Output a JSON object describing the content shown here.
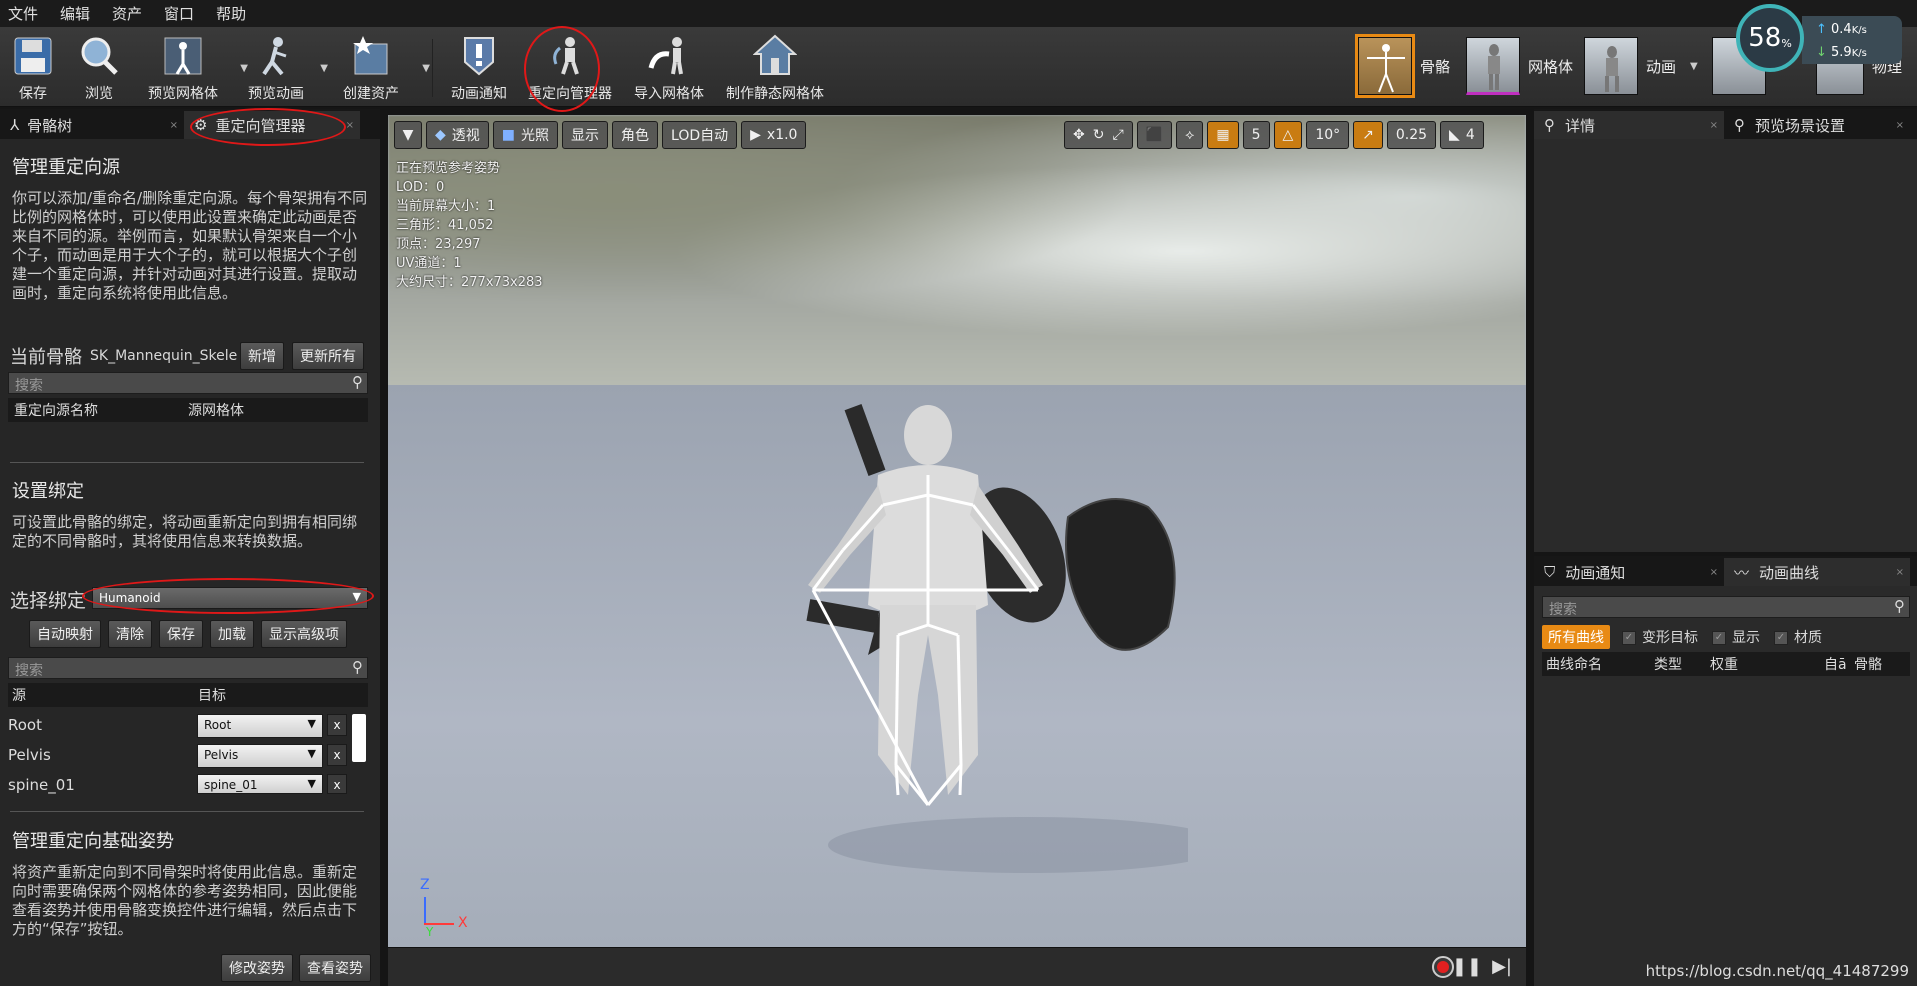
{
  "menu": [
    "文件",
    "编辑",
    "资产",
    "窗口",
    "帮助"
  ],
  "toolbar": {
    "save": "保存",
    "browse": "浏览",
    "preview_mesh": "预览网格体",
    "preview_anim": "预览动画",
    "create_asset": "创建资产",
    "anim_notify": "动画通知",
    "retarget_manager": "重定向管理器",
    "import_mesh": "导入网格体",
    "make_static_mesh": "制作静态网格体"
  },
  "modes": {
    "skeleton": "骨骼",
    "mesh": "网格体",
    "animation": "动画",
    "physics": "物理"
  },
  "net": {
    "percent": "58",
    "percent_unit": "%",
    "up": "0.4",
    "down": "5.9",
    "unit": "K/s"
  },
  "left_tabs": {
    "skeleton_tree": "骨骼树",
    "retarget_manager": "重定向管理器"
  },
  "manage_sources": {
    "title": "管理重定向源",
    "desc": "你可以添加/重命名/删除重定向源。每个骨架拥有不同比例的网格体时，可以使用此设置来确定此动画是否来自不同的源。举例而言，如果默认骨架来自一个小个子，而动画是用于大个子的，就可以根据大个子创建一个重定向源，并针对动画对其进行设置。提取动画时，重定向系统将使用此信息。",
    "current_skeleton_label": "当前骨骼",
    "current_skeleton_value": "SK_Mannequin_Skele",
    "add": "新增",
    "update_all": "更新所有",
    "search_placeholder": "搜索",
    "col_name": "重定向源名称",
    "col_mesh": "源网格体"
  },
  "rig": {
    "title": "设置绑定",
    "desc": "可设置此骨骼的绑定，将动画重新定向到拥有相同绑定的不同骨骼时，其将使用信息来转换数据。",
    "select_label": "选择绑定",
    "select_value": "Humanoid",
    "auto_map": "自动映射",
    "clear": "清除",
    "save": "保存",
    "load": "加载",
    "show_advanced": "显示高级项",
    "search_placeholder": "搜索",
    "col_source": "源",
    "col_target": "目标",
    "rows": [
      {
        "source": "Root",
        "target": "Root"
      },
      {
        "source": "Pelvis",
        "target": "Pelvis"
      },
      {
        "source": "spine_01",
        "target": "spine_01"
      }
    ],
    "x": "x"
  },
  "base_pose": {
    "title": "管理重定向基础姿势",
    "desc": "将资产重新定向到不同骨架时将使用此信息。重新定向时需要确保两个网格体的参考姿势相同，因此便能查看姿势并使用骨骼变换控件进行编辑，然后点击下方的“保存”按钮。",
    "modify": "修改姿势",
    "view": "查看姿势"
  },
  "viewport": {
    "perspective": "透视",
    "lit": "光照",
    "show": "显示",
    "character": "角色",
    "lod_auto": "LOD自动",
    "speed": "x1.0",
    "grid_value": "5",
    "angle_value": "10°",
    "scale_value": "0.25",
    "cam_value": "4",
    "stats": [
      "正在预览参考姿势",
      "LOD：0",
      "当前屏幕大小：1",
      "三角形：41,052",
      "顶点：23,297",
      "UV通道：1",
      "大约尺寸：277x73x283"
    ],
    "axis_z": "Z",
    "axis_x": "X",
    "axis_y": "Y"
  },
  "right_top_tabs": {
    "details": "详情",
    "preview_scene": "预览场景设置"
  },
  "right_bottom_tabs": {
    "anim_notify": "动画通知",
    "anim_curves": "动画曲线"
  },
  "curves": {
    "search_placeholder": "搜索",
    "all_curves": "所有曲线",
    "morph_target": "变形目标",
    "display": "显示",
    "material": "材质",
    "col_name": "曲线命名",
    "col_type": "类型",
    "col_weight": "权重",
    "col_auto": "自ā",
    "col_bone": "骨骼"
  },
  "watermark": "https://blog.csdn.net/qq_41487299",
  "colors": {
    "accent": "#e88a14",
    "annotation": "#e01818"
  }
}
